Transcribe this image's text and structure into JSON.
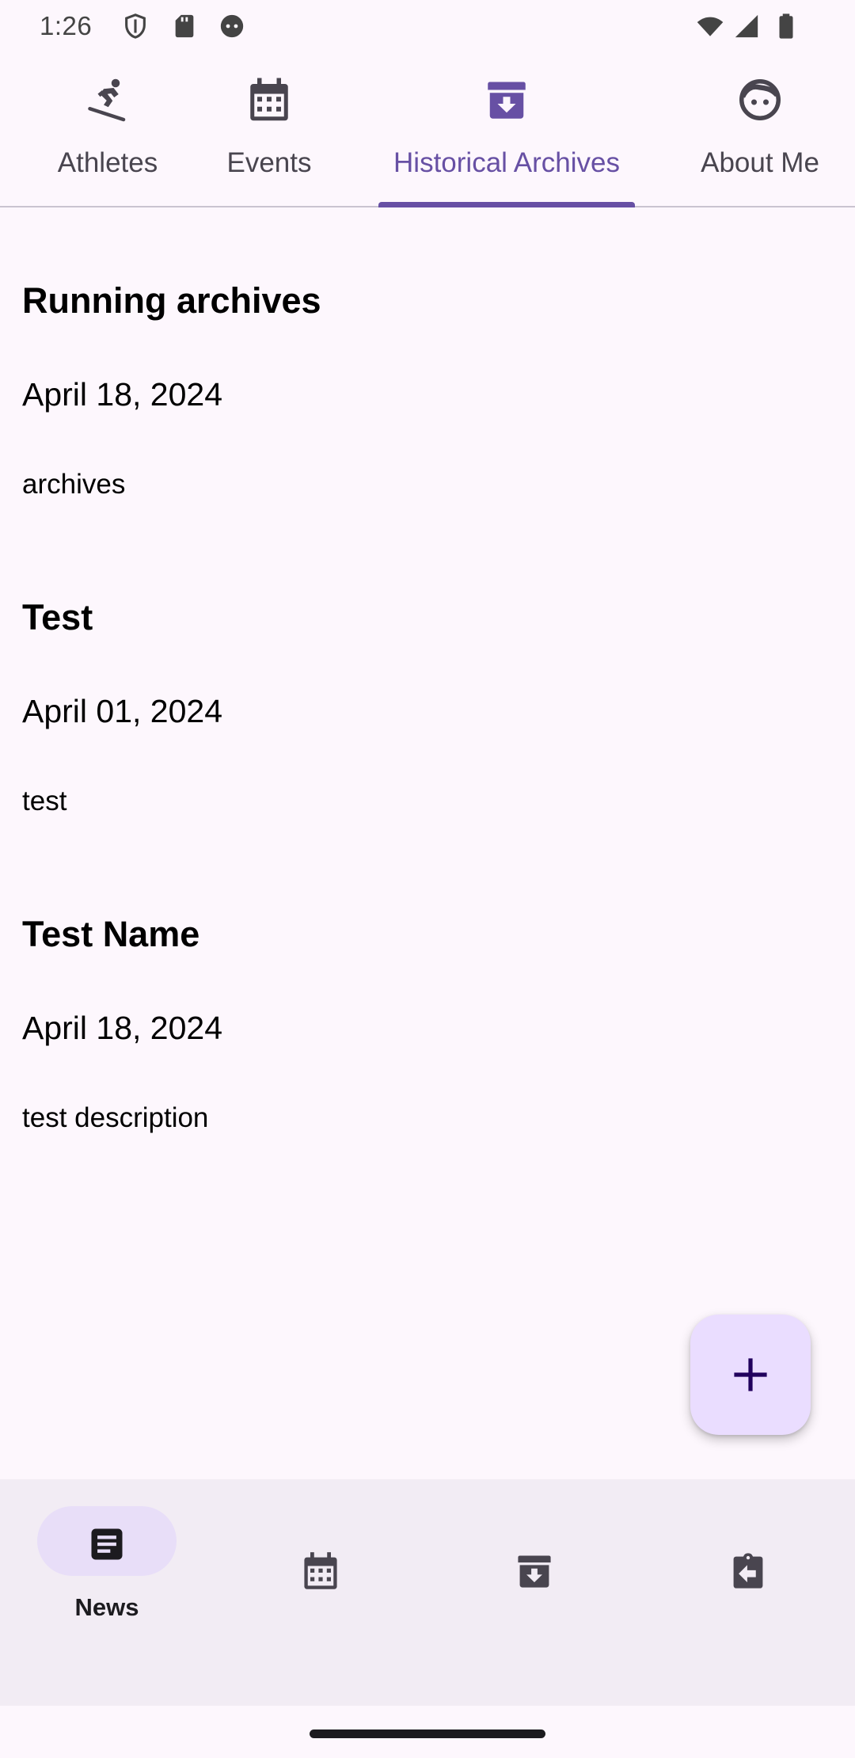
{
  "status_bar": {
    "time": "1:26",
    "left_icons": [
      "shield-icon",
      "sd-card-icon",
      "android-face-icon"
    ],
    "right_icons": [
      "wifi-icon",
      "cellular-signal-icon",
      "battery-icon"
    ]
  },
  "top_tabs": {
    "active_index": 2,
    "items": [
      {
        "label": "Athletes",
        "icon": "snowboarder-icon"
      },
      {
        "label": "Events",
        "icon": "calendar-icon"
      },
      {
        "label": "Historical Archives",
        "icon": "archive-icon"
      },
      {
        "label": "About Me",
        "icon": "face-icon"
      }
    ]
  },
  "archives": [
    {
      "title": "Running archives",
      "date": "April 18, 2024",
      "description": "archives"
    },
    {
      "title": "Test",
      "date": "April 01, 2024",
      "description": "test"
    },
    {
      "title": "Test Name",
      "date": "April 18, 2024",
      "description": "test description"
    }
  ],
  "fab": {
    "icon": "plus-icon"
  },
  "bottom_nav": {
    "active_index": 0,
    "items": [
      {
        "label": "News",
        "icon": "article-icon"
      },
      {
        "label": "",
        "icon": "calendar-icon"
      },
      {
        "label": "",
        "icon": "archive-icon"
      },
      {
        "label": "",
        "icon": "assignment-return-icon"
      }
    ]
  },
  "colors": {
    "background": "#FDF7FD",
    "accent": "#6750A4",
    "fab_container": "#EADDFF",
    "nav_background": "#F2ECF4",
    "nav_pill": "#E8DEF8"
  }
}
